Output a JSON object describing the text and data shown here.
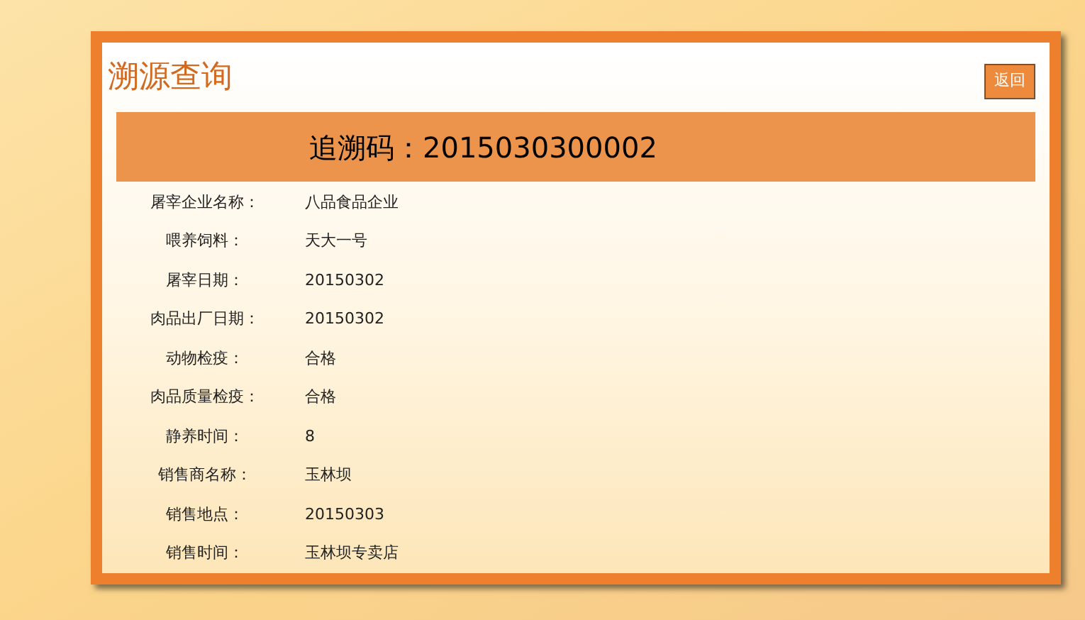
{
  "title": "溯源查询",
  "back_button": "返回",
  "trace_code": {
    "label": "追溯码：",
    "value": "2015030300002"
  },
  "fields": [
    {
      "label": "屠宰企业名称：",
      "value": "八品食品企业"
    },
    {
      "label": "喂养饲料：",
      "value": "天大一号"
    },
    {
      "label": "屠宰日期：",
      "value": "20150302"
    },
    {
      "label": "肉品出厂日期：",
      "value": "20150302"
    },
    {
      "label": "动物检疫：",
      "value": "合格"
    },
    {
      "label": "肉品质量检疫：",
      "value": "合格"
    },
    {
      "label": "静养时间：",
      "value": "8"
    },
    {
      "label": "销售商名称：",
      "value": "玉林坝"
    },
    {
      "label": "销售地点：",
      "value": "20150303"
    },
    {
      "label": "销售时间：",
      "value": "玉林坝专卖店"
    }
  ]
}
